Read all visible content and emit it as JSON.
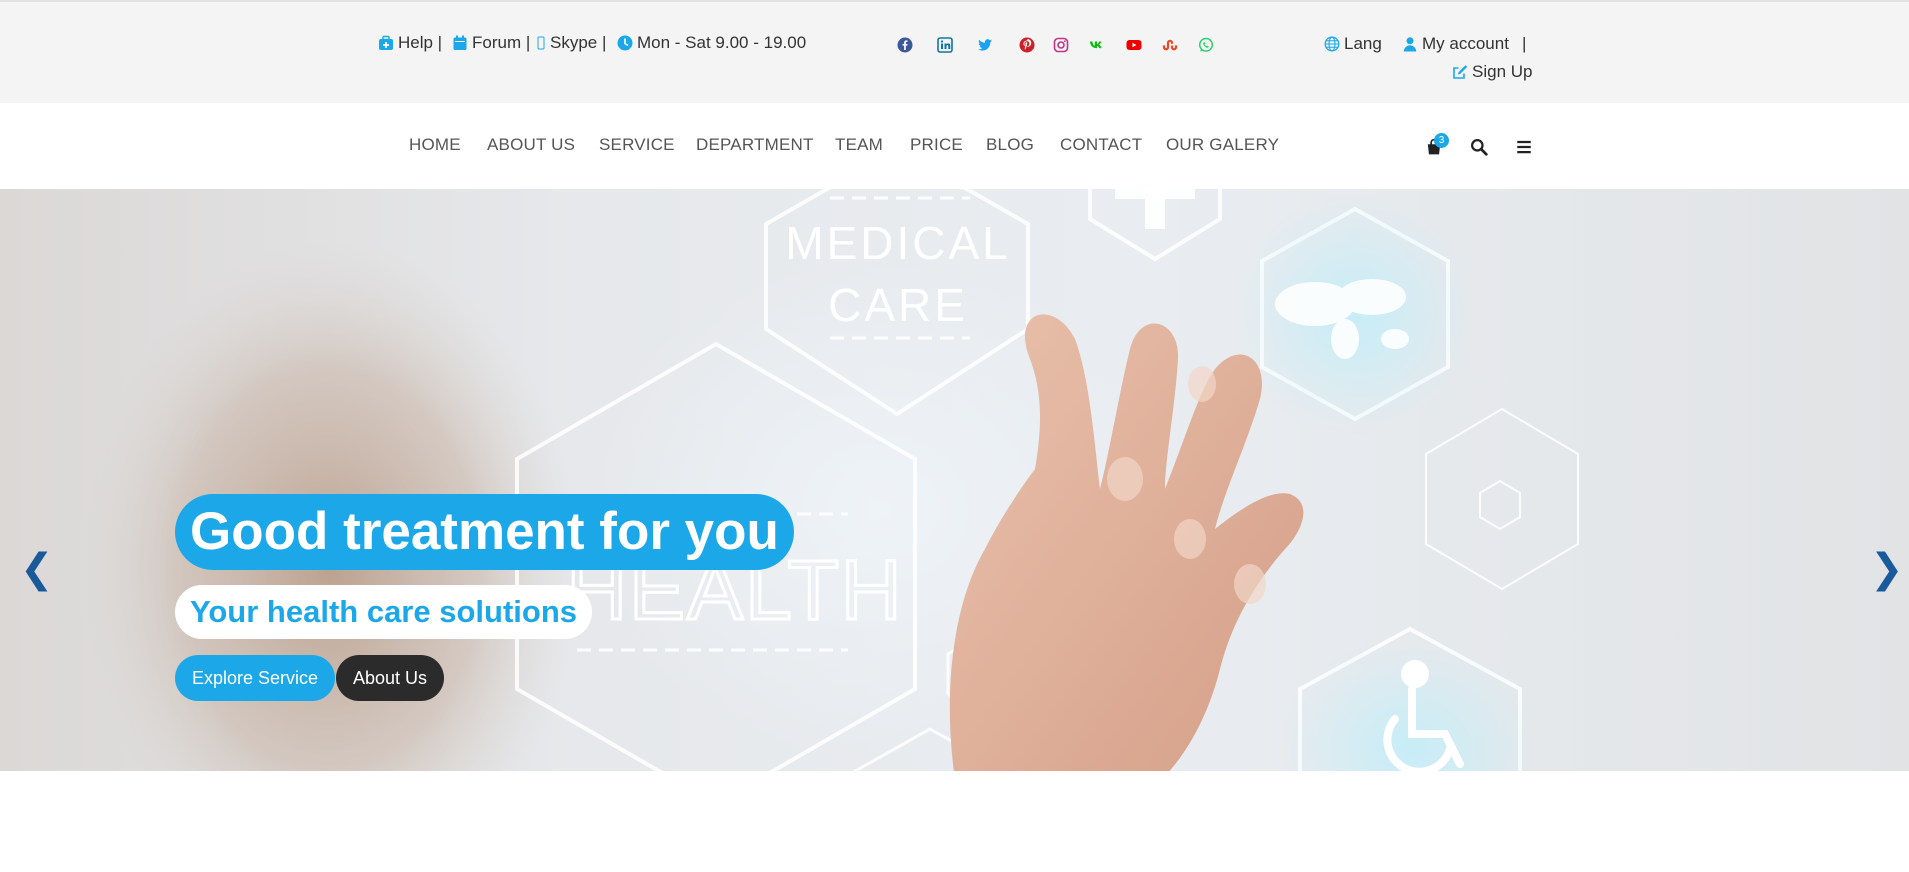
{
  "topbar": {
    "help": "Help |",
    "forum": "Forum |",
    "skype": "Skype |",
    "hours": "Mon - Sat 9.00 - 19.00",
    "lang": "Lang",
    "account": "My account",
    "separator": "|",
    "signup": "Sign Up",
    "social": [
      "facebook-icon",
      "linkedin-icon",
      "twitter-icon",
      "pinterest-icon",
      "instagram-icon",
      "vk-icon",
      "youtube-icon",
      "stumbleupon-icon",
      "whatsapp-icon"
    ]
  },
  "nav": {
    "items": [
      "HOME",
      "ABOUT US",
      "SERVICE",
      "DEPARTMENT",
      "TEAM",
      "PRICE",
      "BLOG",
      "CONTACT",
      "OUR GALERY"
    ],
    "cart_count": "3"
  },
  "hero": {
    "title": "Good treatment for you",
    "subtitle": "Your health care solutions",
    "btn_primary": "Explore Service",
    "btn_secondary": "About Us",
    "prev": "❮",
    "next": "❯",
    "image_text": {
      "medical": "MEDICAL",
      "care": "CARE",
      "health": "HEALTH"
    }
  },
  "colors": {
    "accent": "#1ca8e8",
    "topbar_bg": "#f4f4f4",
    "dark_button": "#2b2b2b",
    "arrow": "#1a5a9a"
  }
}
